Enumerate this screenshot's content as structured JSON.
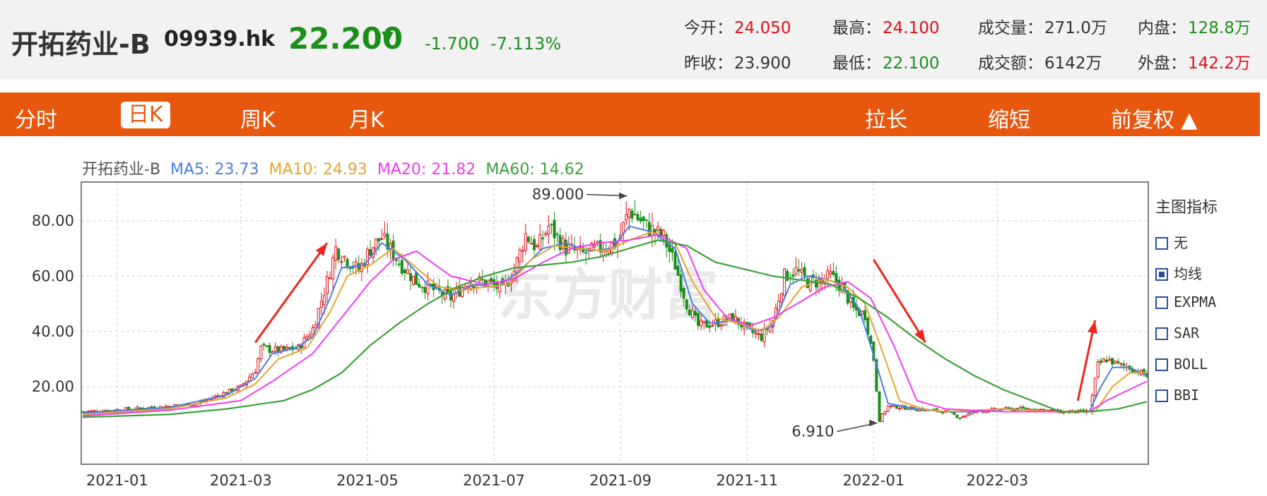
{
  "header": {
    "name": "开拓药业-B",
    "code": "09939.hk",
    "price": "22.200",
    "price_arrow": "▼",
    "change": "-1.700",
    "change_pct": "-7.113%",
    "quotes": [
      {
        "label": "今开：",
        "value": "24.050",
        "color": "red"
      },
      {
        "label": "最高：",
        "value": "24.100",
        "color": "red"
      },
      {
        "label": "成交量：",
        "value": "271.0万",
        "color": "dark"
      },
      {
        "label": "内盘：",
        "value": "128.8万",
        "color": "green"
      },
      {
        "label": "昨收：",
        "value": "23.900",
        "color": "dark"
      },
      {
        "label": "最低：",
        "value": "22.100",
        "color": "green"
      },
      {
        "label": "成交额：",
        "value": "6142万",
        "color": "dark"
      },
      {
        "label": "外盘：",
        "value": "142.2万",
        "color": "red"
      }
    ]
  },
  "tabs": {
    "fenshi": "分时",
    "rik": "日K",
    "zhouk": "周K",
    "yuek": "月K",
    "lachang": "拉长",
    "suoduan": "缩短",
    "fuquan": "前复权 ▲"
  },
  "legend": {
    "name": "开拓药业-B",
    "ma5": "MA5: 23.73",
    "ma10": "MA10: 24.93",
    "ma20": "MA20: 21.82",
    "ma60": "MA60: 14.62"
  },
  "indicator_panel": {
    "title": "主图指标",
    "options": [
      {
        "label": "无",
        "checked": false
      },
      {
        "label": "均线",
        "checked": true
      },
      {
        "label": "EXPMA",
        "checked": false
      },
      {
        "label": "SAR",
        "checked": false
      },
      {
        "label": "BOLL",
        "checked": false
      },
      {
        "label": "BBI",
        "checked": false
      }
    ]
  },
  "colors": {
    "up": "#e0101a",
    "down": "#1a8f1a",
    "ma5": "#4c7de8",
    "ma10": "#e5a531",
    "ma20": "#f03cf0",
    "ma60": "#3aa33a",
    "tab_bg": "#e8570e"
  },
  "chart_data": {
    "type": "candlestick",
    "watermark": "东方财富",
    "x_ticks": [
      "2021-01",
      "2021-03",
      "2021-05",
      "2021-07",
      "2021-09",
      "2021-11",
      "2022-01",
      "2022-03"
    ],
    "y_ticks": [
      "20.00",
      "40.00",
      "60.00",
      "80.00"
    ],
    "ylim": [
      -8,
      94
    ],
    "grid": true,
    "annotations": [
      {
        "text": "89.000",
        "type": "high",
        "value": 89.0,
        "date": "2021-09"
      },
      {
        "text": "6.910",
        "type": "low",
        "value": 6.91,
        "date": "2021-12"
      }
    ],
    "trend_arrows": [
      {
        "direction": "up",
        "from_date": "2021-03",
        "to_date": "2021-04"
      },
      {
        "direction": "down",
        "from_date": "2021-12",
        "to_date": "2022-01"
      },
      {
        "direction": "up",
        "from_date": "2022-04",
        "to_date": "2022-04"
      }
    ],
    "close_path": [
      [
        0,
        11
      ],
      [
        10,
        11.5
      ],
      [
        30,
        13
      ],
      [
        40,
        14
      ],
      [
        45,
        16
      ],
      [
        50,
        18
      ],
      [
        55,
        20
      ],
      [
        60,
        26
      ],
      [
        62,
        34
      ],
      [
        68,
        33
      ],
      [
        75,
        34
      ],
      [
        80,
        41
      ],
      [
        85,
        58
      ],
      [
        88,
        70
      ],
      [
        92,
        66
      ],
      [
        96,
        62
      ],
      [
        100,
        70
      ],
      [
        104,
        74
      ],
      [
        110,
        65
      ],
      [
        116,
        58
      ],
      [
        122,
        55
      ],
      [
        128,
        52
      ],
      [
        134,
        58
      ],
      [
        140,
        58
      ],
      [
        146,
        55
      ],
      [
        150,
        62
      ],
      [
        154,
        75
      ],
      [
        158,
        70
      ],
      [
        162,
        78
      ],
      [
        168,
        70
      ],
      [
        174,
        68
      ],
      [
        180,
        70
      ],
      [
        186,
        72
      ],
      [
        190,
        84
      ],
      [
        196,
        78
      ],
      [
        202,
        74
      ],
      [
        206,
        64
      ],
      [
        210,
        50
      ],
      [
        214,
        42
      ],
      [
        220,
        43
      ],
      [
        226,
        45
      ],
      [
        232,
        40
      ],
      [
        236,
        38
      ],
      [
        240,
        44
      ],
      [
        244,
        60
      ],
      [
        248,
        62
      ],
      [
        252,
        58
      ],
      [
        256,
        58
      ],
      [
        260,
        60
      ],
      [
        264,
        56
      ],
      [
        268,
        48
      ],
      [
        272,
        46
      ],
      [
        275,
        30
      ],
      [
        277,
        8
      ],
      [
        280,
        13
      ],
      [
        290,
        12
      ],
      [
        300,
        11
      ],
      [
        305,
        9
      ],
      [
        310,
        11
      ],
      [
        320,
        12
      ],
      [
        330,
        12
      ],
      [
        340,
        11
      ],
      [
        346,
        11
      ],
      [
        350,
        11
      ],
      [
        353,
        28
      ],
      [
        356,
        30
      ],
      [
        360,
        28
      ],
      [
        364,
        27
      ],
      [
        368,
        25
      ],
      [
        370,
        24
      ]
    ],
    "moving_averages": [
      {
        "name": "MA5",
        "current": 23.73,
        "path": [
          [
            0,
            10.5
          ],
          [
            30,
            12.5
          ],
          [
            50,
            17
          ],
          [
            60,
            23
          ],
          [
            66,
            32
          ],
          [
            74,
            34
          ],
          [
            80,
            38
          ],
          [
            86,
            52
          ],
          [
            90,
            63
          ],
          [
            98,
            64
          ],
          [
            104,
            72
          ],
          [
            112,
            66
          ],
          [
            120,
            57
          ],
          [
            128,
            53
          ],
          [
            136,
            57
          ],
          [
            144,
            56
          ],
          [
            152,
            62
          ],
          [
            160,
            70
          ],
          [
            168,
            72
          ],
          [
            176,
            69
          ],
          [
            184,
            70
          ],
          [
            190,
            78
          ],
          [
            198,
            76
          ],
          [
            206,
            70
          ],
          [
            212,
            50
          ],
          [
            218,
            43
          ],
          [
            226,
            44
          ],
          [
            234,
            40
          ],
          [
            240,
            42
          ],
          [
            246,
            57
          ],
          [
            252,
            60
          ],
          [
            258,
            59
          ],
          [
            264,
            57
          ],
          [
            270,
            48
          ],
          [
            276,
            28
          ],
          [
            280,
            14
          ],
          [
            290,
            12
          ],
          [
            300,
            11
          ],
          [
            310,
            11
          ],
          [
            320,
            12
          ],
          [
            340,
            11
          ],
          [
            350,
            11
          ],
          [
            354,
            20
          ],
          [
            358,
            27
          ],
          [
            364,
            27
          ],
          [
            370,
            24
          ]
        ]
      },
      {
        "name": "MA10",
        "current": 24.93,
        "path": [
          [
            0,
            10
          ],
          [
            30,
            12
          ],
          [
            50,
            16
          ],
          [
            60,
            21
          ],
          [
            68,
            30
          ],
          [
            78,
            34
          ],
          [
            86,
            47
          ],
          [
            92,
            60
          ],
          [
            100,
            64
          ],
          [
            108,
            70
          ],
          [
            116,
            63
          ],
          [
            124,
            56
          ],
          [
            132,
            55
          ],
          [
            140,
            56
          ],
          [
            148,
            57
          ],
          [
            156,
            66
          ],
          [
            164,
            71
          ],
          [
            172,
            70
          ],
          [
            182,
            69
          ],
          [
            190,
            73
          ],
          [
            198,
            76
          ],
          [
            206,
            72
          ],
          [
            212,
            58
          ],
          [
            220,
            45
          ],
          [
            228,
            43
          ],
          [
            236,
            40
          ],
          [
            242,
            45
          ],
          [
            250,
            56
          ],
          [
            258,
            59
          ],
          [
            266,
            56
          ],
          [
            272,
            50
          ],
          [
            278,
            33
          ],
          [
            284,
            15
          ],
          [
            292,
            12
          ],
          [
            300,
            11
          ],
          [
            320,
            12
          ],
          [
            340,
            11
          ],
          [
            352,
            11
          ],
          [
            358,
            20
          ],
          [
            364,
            25
          ],
          [
            370,
            25
          ]
        ]
      },
      {
        "name": "MA20",
        "current": 21.82,
        "path": [
          [
            0,
            9.5
          ],
          [
            30,
            11.5
          ],
          [
            55,
            15
          ],
          [
            66,
            22
          ],
          [
            80,
            32
          ],
          [
            90,
            45
          ],
          [
            100,
            58
          ],
          [
            108,
            66
          ],
          [
            116,
            69
          ],
          [
            128,
            60
          ],
          [
            140,
            57
          ],
          [
            150,
            59
          ],
          [
            160,
            65
          ],
          [
            170,
            70
          ],
          [
            180,
            72
          ],
          [
            190,
            73
          ],
          [
            200,
            75
          ],
          [
            210,
            70
          ],
          [
            216,
            55
          ],
          [
            224,
            45
          ],
          [
            232,
            42
          ],
          [
            240,
            45
          ],
          [
            250,
            51
          ],
          [
            258,
            56
          ],
          [
            266,
            58
          ],
          [
            274,
            52
          ],
          [
            282,
            35
          ],
          [
            290,
            15
          ],
          [
            300,
            12
          ],
          [
            320,
            11
          ],
          [
            340,
            11
          ],
          [
            350,
            11
          ],
          [
            356,
            15
          ],
          [
            362,
            18
          ],
          [
            370,
            22
          ]
        ]
      },
      {
        "name": "MA60",
        "current": 14.62,
        "path": [
          [
            0,
            9
          ],
          [
            30,
            10
          ],
          [
            50,
            12
          ],
          [
            70,
            15
          ],
          [
            80,
            19
          ],
          [
            90,
            25
          ],
          [
            100,
            35
          ],
          [
            110,
            43
          ],
          [
            120,
            50
          ],
          [
            130,
            56
          ],
          [
            140,
            60
          ],
          [
            150,
            63
          ],
          [
            160,
            64
          ],
          [
            170,
            65
          ],
          [
            180,
            67
          ],
          [
            190,
            70
          ],
          [
            200,
            73
          ],
          [
            210,
            71
          ],
          [
            220,
            65
          ],
          [
            240,
            60
          ],
          [
            260,
            57
          ],
          [
            270,
            52
          ],
          [
            280,
            45
          ],
          [
            290,
            37
          ],
          [
            300,
            30
          ],
          [
            310,
            24
          ],
          [
            320,
            19
          ],
          [
            330,
            15
          ],
          [
            340,
            11
          ],
          [
            350,
            11
          ],
          [
            360,
            12
          ],
          [
            370,
            14.6
          ]
        ]
      }
    ]
  }
}
